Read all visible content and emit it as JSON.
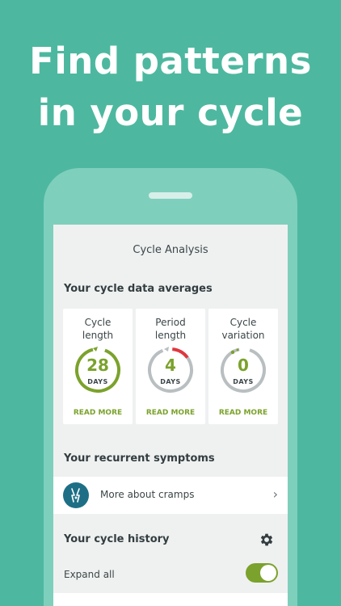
{
  "headline": {
    "line1": "Find patterns",
    "line2": "in your cycle"
  },
  "screen": {
    "title": "Cycle Analysis",
    "averages": {
      "title": "Your cycle data averages",
      "cards": [
        {
          "label1": "Cycle",
          "label2": "length",
          "value": "28",
          "unit": "DAYS",
          "link": "READ MORE"
        },
        {
          "label1": "Period",
          "label2": "length",
          "value": "4",
          "unit": "DAYS",
          "link": "READ MORE"
        },
        {
          "label1": "Cycle",
          "label2": "variation",
          "value": "0",
          "unit": "DAYS",
          "link": "READ MORE"
        }
      ]
    },
    "symptoms": {
      "title": "Your recurrent symptoms",
      "row_label": "More about cramps"
    },
    "history": {
      "title": "Your cycle history",
      "expand_label": "Expand all",
      "expand_on": true
    }
  },
  "colors": {
    "background": "#4db89f",
    "accent_green": "#7ba22c",
    "period_red": "#e0373f",
    "ring_gray": "#b9bfc1",
    "symptom_blue": "#1e6f85"
  },
  "icons": {
    "symptom": "cramps-lightning-icon",
    "settings": "gear-icon",
    "chevron": "chevron-right-icon"
  }
}
